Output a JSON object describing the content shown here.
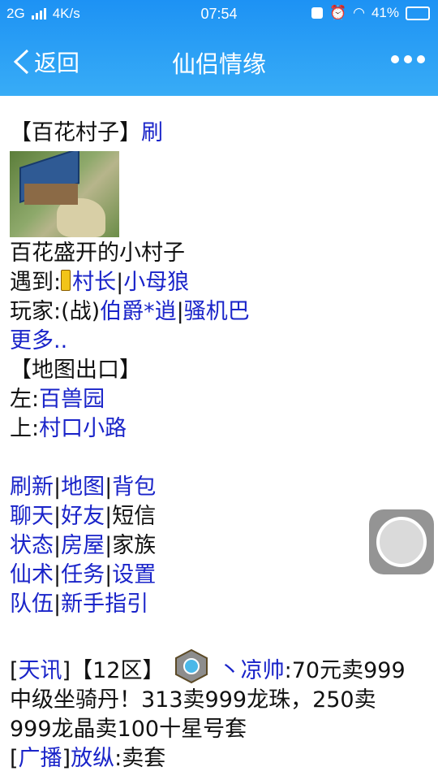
{
  "status_bar": {
    "network": "2G",
    "speed": "4K/s",
    "time": "07:54",
    "battery": "41%"
  },
  "nav": {
    "back_label": "返回",
    "title": "仙侣情缘"
  },
  "page": {
    "location_title": "【百花村子】",
    "refresh_link": "刷",
    "description": "百花盛开的小村子",
    "encounter_prefix": "遇到:",
    "npc1": "村长",
    "sep1": "|",
    "npc2": "小母狼",
    "players_prefix": "玩家:(战)",
    "player1": "伯爵*逍",
    "sep2": "|",
    "player2": "骚机巴",
    "more_link": "更多..",
    "exits_title": "【地图出口】",
    "exit_left_prefix": "左:",
    "exit_left": "百兽园",
    "exit_up_prefix": "上:",
    "exit_up": "村口小路"
  },
  "menu": {
    "row1": [
      "刷新",
      "地图",
      "背包"
    ],
    "row2": [
      "聊天",
      "好友",
      "短信"
    ],
    "row3": [
      "状态",
      "房屋",
      "家族"
    ],
    "row4": [
      "仙术",
      "任务",
      "设置"
    ],
    "row5": [
      "队伍",
      "新手指引"
    ],
    "sep": "|"
  },
  "news": {
    "tag1": "天讯",
    "lb": "[",
    "rb": "]",
    "zone": "【12区】",
    "user1": "丶凉帅",
    "msg1_a": ":70元卖999",
    "msg1_b": "中级坐骑丹！313卖999龙珠，250卖",
    "msg1_c": "999龙晶卖100十星号套",
    "tag2": "广播",
    "user2": "放纵",
    "msg2": ":卖套"
  }
}
